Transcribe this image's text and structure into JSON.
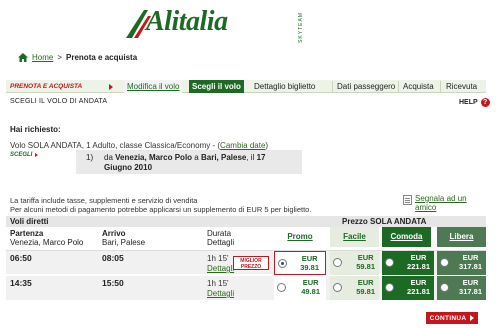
{
  "brand": {
    "name": "Alitalia",
    "skyteam": "SKYTEAM",
    "accent": "#1d6a25",
    "red": "#c4161c"
  },
  "breadcrumb": {
    "home": "Home",
    "separator": ">",
    "current": "Prenota e acquista"
  },
  "steps": {
    "prenota_label": "PRENOTA E ACQUISTA",
    "items": [
      {
        "label": "Modifica il volo",
        "state": "done"
      },
      {
        "label": "Scegli il volo",
        "state": "active"
      },
      {
        "label": "Dettaglio biglietto",
        "state": "todo"
      },
      {
        "label": "Dati passeggero",
        "state": "todo"
      },
      {
        "label": "Acquista",
        "state": "todo"
      },
      {
        "label": "Ricevuta",
        "state": "todo"
      }
    ]
  },
  "section_title": "SCEGLI IL VOLO DI ANDATA",
  "help_label": "HELP",
  "help_icon": "?",
  "request": {
    "title": "Hai richiesto:",
    "line_text": "Volo SOLA ANDATA, 1 Adulto, classe Classica/Economy -",
    "line_open": "(",
    "change_link": "Cambia date",
    "line_close": ")",
    "scegli_label": "SCEGLI",
    "route_number": "1)",
    "route_da": "da",
    "route_from": "Venezia, Marco Polo",
    "route_a": "a",
    "route_to": "Bari, Palese",
    "route_il": ", il",
    "route_date": "17 Giugno 2010"
  },
  "notes": {
    "line1": "La tariffa include tasse, supplementi e servizio di vendita",
    "line2": "Per alcuni metodi di pagamento potrebbe applicarsi un supplemento di EUR 5 per biglietto.",
    "segnala": "Segnala ad un amico"
  },
  "table": {
    "header_left": "Voli diretti",
    "header_right": "Prezzo SOLA ANDATA",
    "col_partenza": "Partenza",
    "col_partenza_sub": "Venezia, Marco Polo",
    "col_arrivo": "Arrivo",
    "col_arrivo_sub": "Bari, Palese",
    "col_durata": "Durata",
    "col_durata_sub": "Dettagli",
    "fares": [
      "Promo",
      "Facile",
      "Comoda",
      "Libera"
    ],
    "rows": [
      {
        "dep": "06:50",
        "arr": "08:05",
        "duration": "1h 15'",
        "details": "Dettagli",
        "prices": [
          {
            "cur": "EUR",
            "amount": "39.81",
            "selected": true
          },
          {
            "cur": "EUR",
            "amount": "59.81"
          },
          {
            "cur": "EUR",
            "amount": "221.81"
          },
          {
            "cur": "EUR",
            "amount": "317.81"
          }
        ]
      },
      {
        "dep": "14:35",
        "arr": "15:50",
        "duration": "1h 15'",
        "details": "Dettagli",
        "prices": [
          {
            "cur": "EUR",
            "amount": "49.81"
          },
          {
            "cur": "EUR",
            "amount": "59.81"
          },
          {
            "cur": "EUR",
            "amount": "221.81"
          },
          {
            "cur": "EUR",
            "amount": "317.81"
          }
        ]
      }
    ],
    "miglior_line1": "MIGLIOR",
    "miglior_line2": "PREZZO"
  },
  "continua_label": "CONTINUA"
}
